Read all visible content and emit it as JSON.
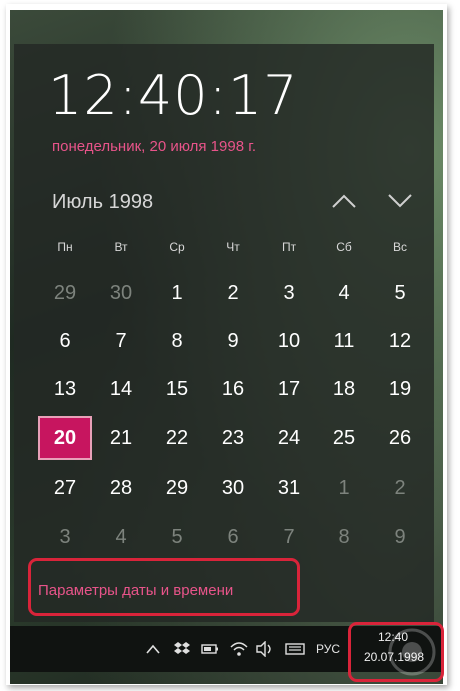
{
  "flyout": {
    "time": "12:40:17",
    "long_date": "понедельник, 20 июля 1998 г.",
    "month_label": "Июль 1998"
  },
  "calendar": {
    "weekdays": [
      "Пн",
      "Вт",
      "Ср",
      "Чт",
      "Пт",
      "Сб",
      "Вс"
    ],
    "weeks": [
      [
        "29",
        "30",
        "1",
        "2",
        "3",
        "4",
        "5"
      ],
      [
        "6",
        "7",
        "8",
        "9",
        "10",
        "11",
        "12"
      ],
      [
        "13",
        "14",
        "15",
        "16",
        "17",
        "18",
        "19"
      ],
      [
        "20",
        "21",
        "22",
        "23",
        "24",
        "25",
        "26"
      ],
      [
        "27",
        "28",
        "29",
        "30",
        "31",
        "1",
        "2"
      ],
      [
        "3",
        "4",
        "5",
        "6",
        "7",
        "8",
        "9"
      ]
    ],
    "selected_day": "20"
  },
  "settings": {
    "link_label": "Параметры даты и времени"
  },
  "taskbar": {
    "icons": [
      "chevron-up-icon",
      "dropbox-icon",
      "battery-icon",
      "wifi-icon",
      "volume-icon",
      "keyboard-icon"
    ],
    "language": "РУС",
    "time": "12:40",
    "date": "20.07.1998"
  },
  "colors": {
    "accent": "#c7155f",
    "link": "#e8548a",
    "highlight_outline": "#d9243a"
  }
}
